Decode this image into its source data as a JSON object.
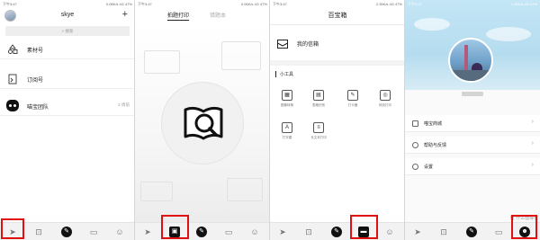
{
  "status_bars": [
    {
      "left": "下午3:47",
      "right": "0.08K/s 4G 47%"
    },
    {
      "left": "下午3:47",
      "right": "0.06K/s 4G 47%"
    },
    {
      "left": "下午3:47",
      "right": "2.35K/s 4G 47%"
    },
    {
      "left": "下午3:47",
      "right": "1.39K/s 4G 47%"
    }
  ],
  "panel1": {
    "title": "skye",
    "plus": "+",
    "search_placeholder": "搜索",
    "items": [
      {
        "label": "素材号",
        "icon": "shapes-icon"
      },
      {
        "label": "订阅号",
        "icon": "subscription-icon"
      },
      {
        "label": "喵宝团队",
        "icon": "cat-icon",
        "time": "2 周前"
      }
    ]
  },
  "panel2": {
    "tabs": [
      {
        "label": "拍题打印",
        "active": true
      },
      {
        "label": "错题本",
        "active": false
      }
    ]
  },
  "panel3": {
    "title": "百宝箱",
    "mailbox": "我的信箱",
    "tools_title": "小工具",
    "tools": [
      {
        "label": "图像转换",
        "glyph": "▦"
      },
      {
        "label": "表格识别",
        "glyph": "▤"
      },
      {
        "label": "打卡器",
        "glyph": "✎"
      },
      {
        "label": "网页打印",
        "glyph": "◎"
      },
      {
        "label": "打字模",
        "glyph": "A"
      },
      {
        "label": "长文本打印",
        "glyph": "≡"
      }
    ]
  },
  "panel4": {
    "menu": [
      {
        "label": "喵宝商城",
        "chev": "›"
      },
      {
        "label": "帮助与反馈",
        "chev": "›"
      },
      {
        "label": "设置",
        "chev": "›"
      }
    ]
  },
  "watermark": "值 什么值得买",
  "accent": "#e01010"
}
